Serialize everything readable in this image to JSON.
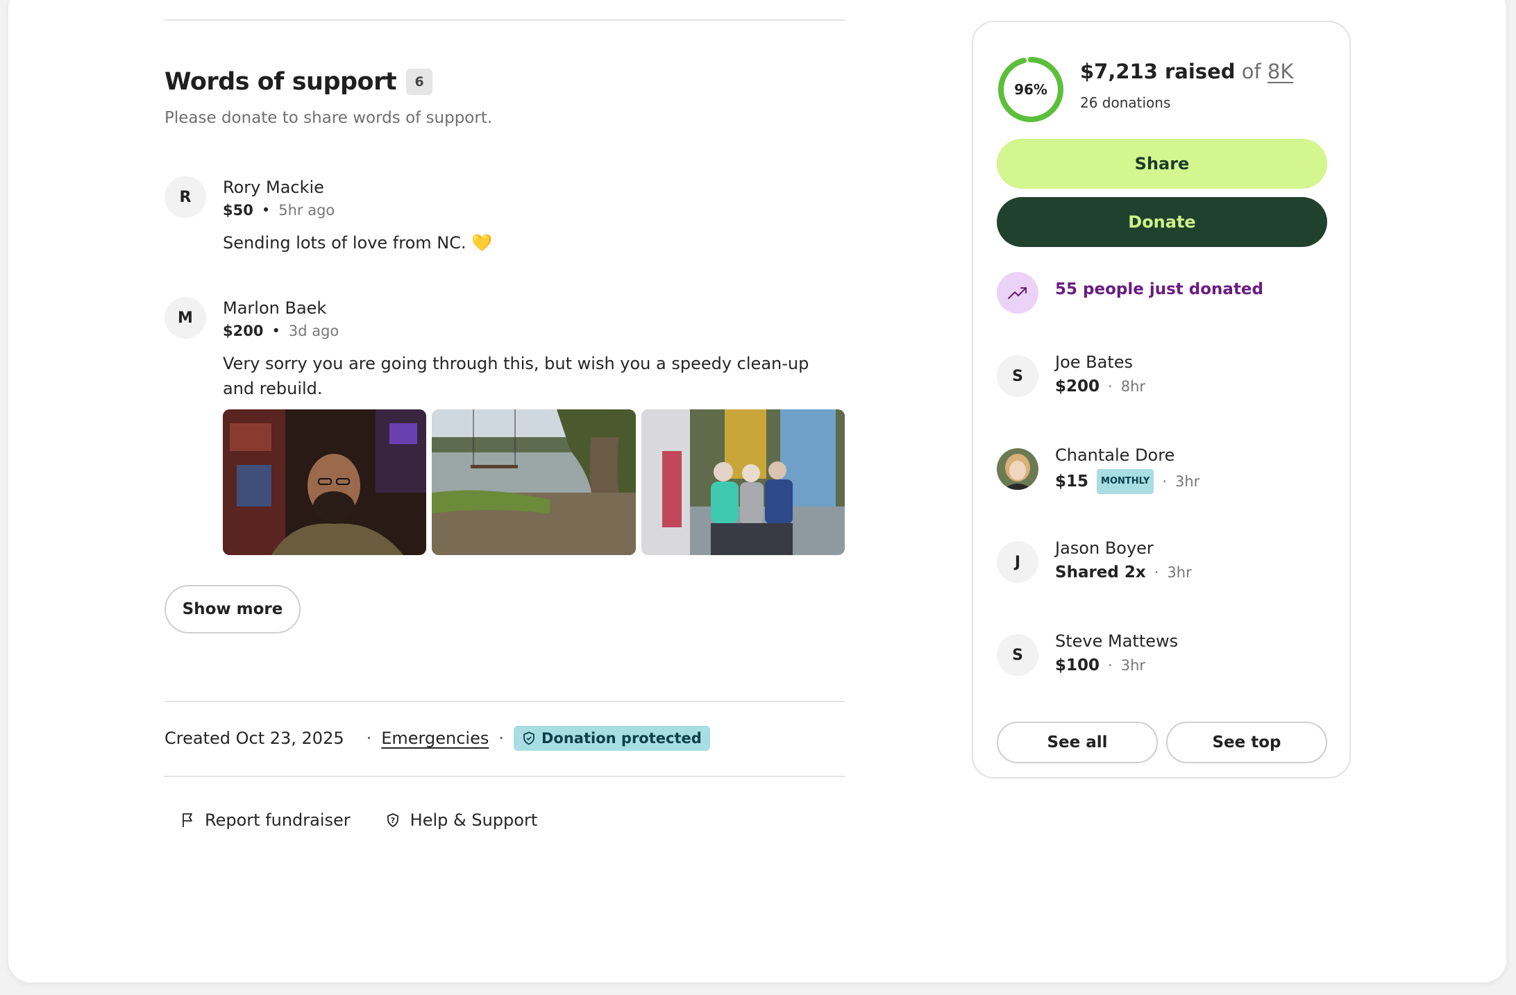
{
  "words_of_support": {
    "title": "Words of support",
    "count": "6",
    "subtitle": "Please donate to share words of support."
  },
  "comments": [
    {
      "initial": "R",
      "name": "Rory Mackie",
      "amount": "$50",
      "time": "5hr ago",
      "text": "Sending lots of love from NC. 💛"
    },
    {
      "initial": "M",
      "name": "Marlon Baek",
      "amount": "$200",
      "time": "3d ago",
      "text": "Very sorry you are going through this, but wish you a speedy clean-up and rebuild."
    }
  ],
  "show_more_label": "Show more",
  "meta": {
    "created": "Created Oct 23, 2025",
    "category": "Emergencies",
    "protected": "Donation protected"
  },
  "footer": {
    "report": "Report fundraiser",
    "help": "Help & Support"
  },
  "sidebar": {
    "progress_percent": "96%",
    "progress_value": 0.96,
    "raised": "$7,213 raised",
    "of": "of",
    "goal": "8K",
    "donations_count": "26 donations",
    "share_label": "Share",
    "donate_label": "Donate",
    "trend_text": "55 people just donated",
    "donors": [
      {
        "initial": "S",
        "name": "Joe Bates",
        "amount": "$200",
        "time": "8hr",
        "badge": ""
      },
      {
        "initial": "",
        "name": "Chantale Dore",
        "amount": "$15",
        "time": "3hr",
        "badge": "MONTHLY"
      },
      {
        "initial": "J",
        "name": "Jason Boyer",
        "amount": "Shared 2x",
        "time": "3hr",
        "badge": ""
      },
      {
        "initial": "S",
        "name": "Steve Mattews",
        "amount": "$100",
        "time": "3hr",
        "badge": ""
      }
    ],
    "see_all_label": "See all",
    "see_top_label": "See top"
  },
  "colors": {
    "share_bg": "#d3f68f",
    "donate_bg": "#21412f",
    "progress": "#5bbf3a",
    "trend": "#6a1c80",
    "protected_bg": "#a8dde3"
  }
}
